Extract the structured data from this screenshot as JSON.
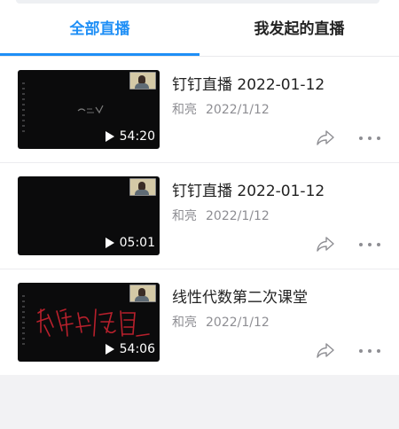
{
  "tabs": {
    "all_label": "全部直播",
    "mine_label": "我发起的直播"
  },
  "items": [
    {
      "title": "钉钉直播 2022-01-12",
      "author": "和亮",
      "date": "2022/1/12",
      "duration": "54:20"
    },
    {
      "title": "钉钉直播 2022-01-12",
      "author": "和亮",
      "date": "2022/1/12",
      "duration": "05:01"
    },
    {
      "title": "线性代数第二次课堂",
      "author": "和亮",
      "date": "2022/1/12",
      "duration": "54:06"
    }
  ],
  "colors": {
    "accent": "#1f8ff6",
    "title_text": "#222222",
    "meta_text": "#8e8e93",
    "handwriting": "#b8202c"
  },
  "icons": {
    "play": "play-icon",
    "share": "share-icon",
    "more": "more-icon",
    "camera": "camera-overlay"
  }
}
